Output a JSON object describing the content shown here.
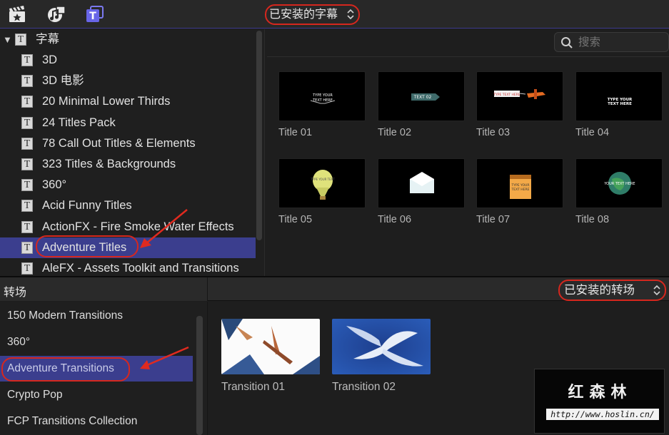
{
  "titles_browser": {
    "selector_label": "已安装的字幕",
    "selector_chevron": "⌃⌄",
    "search_placeholder": "搜索",
    "root_label": "字幕",
    "items": [
      "3D",
      "3D 电影",
      "20 Minimal Lower Thirds",
      "24 Titles Pack",
      "78 Call Out Titles & Elements",
      "323 Titles & Backgrounds",
      "360°",
      "Acid Funny Titles",
      "ActionFX - Fire Smoke Water Effects",
      "Adventure Titles",
      "AleFX - Assets Toolkit and Transitions"
    ],
    "selected_item": "Adventure Titles",
    "thumbnails": [
      {
        "label": "Title 01",
        "preview_text": "TYPE YOUR TEXT HERE"
      },
      {
        "label": "Title 02",
        "preview_text": "TEXT 02"
      },
      {
        "label": "Title 03",
        "preview_text": "TYPE TEXT HERE"
      },
      {
        "label": "Title 04",
        "preview_text": "TYPE YOUR TEXT HERE"
      },
      {
        "label": "Title 05",
        "preview_text": "TYPE YOUR TEXT"
      },
      {
        "label": "Title 06",
        "preview_text": ""
      },
      {
        "label": "Title 07",
        "preview_text": "TYPE YOUR TEXT HERE"
      },
      {
        "label": "Title 08",
        "preview_text": "YOUR TEXT HERE"
      }
    ]
  },
  "transitions_browser": {
    "heading": "转场",
    "selector_label": "已安装的转场",
    "selector_chevron": "⌃⌄",
    "items": [
      "150 Modern Transitions",
      "360°",
      "Adventure Transitions",
      "Crypto Pop",
      "FCP Transitions Collection"
    ],
    "selected_item": "Adventure Transitions",
    "thumbnails": [
      {
        "label": "Transition 01"
      },
      {
        "label": "Transition 02"
      }
    ]
  },
  "watermark": {
    "title": "红森林",
    "url": "http://www.hoslin.cn/"
  },
  "colors": {
    "accent_selection": "#3b3e8e",
    "highlight_circle": "#d6271e",
    "toolbar_bg": "#282828",
    "panel_bg": "#1e1e1e"
  },
  "icons": [
    "clapper-star-icon",
    "music-photo-icon",
    "titles-icon",
    "search-icon",
    "disclosure-triangle-icon",
    "title-glyph-icon"
  ]
}
